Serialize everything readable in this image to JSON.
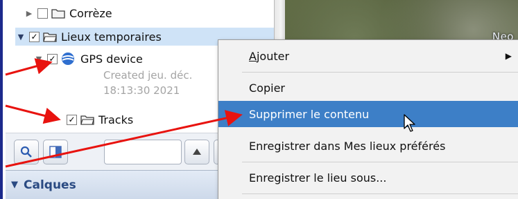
{
  "tree": {
    "item_correze": {
      "label": "Corrèze",
      "checked": false,
      "expanded": false
    },
    "item_lieux": {
      "label": "Lieux temporaires",
      "checked": true,
      "expanded": true
    },
    "item_gps": {
      "label": "GPS device",
      "checked": true,
      "expanded": true
    },
    "gps_meta": {
      "line1": "Created jeu. déc.",
      "line2": "18:13:30 2021"
    },
    "item_tracks": {
      "label": "Tracks",
      "checked": true
    }
  },
  "map": {
    "label": "Neo"
  },
  "layers": {
    "label": "Calques"
  },
  "context_menu": {
    "items": [
      {
        "label_accel": "A",
        "label_rest": "jouter",
        "has_submenu": true
      },
      {
        "label": "Copier"
      },
      {
        "label": "Supprimer le contenu",
        "highlighted": true
      },
      {
        "label": "Enregistrer dans Mes lieux préférés"
      },
      {
        "label": "Enregistrer le lieu sous..."
      }
    ]
  },
  "colors": {
    "selection": "#cfe3f7",
    "menu_highlight": "#3d7fc7",
    "annotation_arrow": "#e8130f"
  }
}
